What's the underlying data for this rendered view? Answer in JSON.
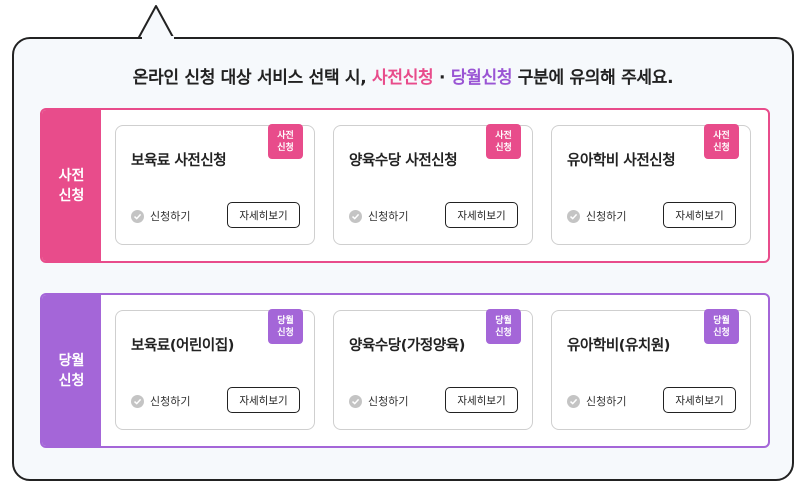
{
  "headline": {
    "part1": "온라인 신청 대상 서비스 선택 시, ",
    "pre": "사전신청",
    "dot": " · ",
    "same": "당월신청",
    "part2": " 구분에 유의해 주세요."
  },
  "colors": {
    "pre_accent": "#e84c8b",
    "same_accent": "#a466d8",
    "border": "#222222",
    "background": "#f6f9fc"
  },
  "groups": [
    {
      "label_line1": "사전",
      "label_line2": "신청",
      "cards": [
        {
          "title": "보육료 사전신청",
          "tag_line1": "사전",
          "tag_line2": "신청",
          "apply": "신청하기",
          "detail": "자세히보기"
        },
        {
          "title": "양육수당 사전신청",
          "tag_line1": "사전",
          "tag_line2": "신청",
          "apply": "신청하기",
          "detail": "자세히보기"
        },
        {
          "title": "유아학비 사전신청",
          "tag_line1": "사전",
          "tag_line2": "신청",
          "apply": "신청하기",
          "detail": "자세히보기"
        }
      ]
    },
    {
      "label_line1": "당월",
      "label_line2": "신청",
      "cards": [
        {
          "title": "보육료(어린이집)",
          "tag_line1": "당월",
          "tag_line2": "신청",
          "apply": "신청하기",
          "detail": "자세히보기"
        },
        {
          "title": "양육수당(가정양육)",
          "tag_line1": "당월",
          "tag_line2": "신청",
          "apply": "신청하기",
          "detail": "자세히보기"
        },
        {
          "title": "유아학비(유치원)",
          "tag_line1": "당월",
          "tag_line2": "신청",
          "apply": "신청하기",
          "detail": "자세히보기"
        }
      ]
    }
  ]
}
